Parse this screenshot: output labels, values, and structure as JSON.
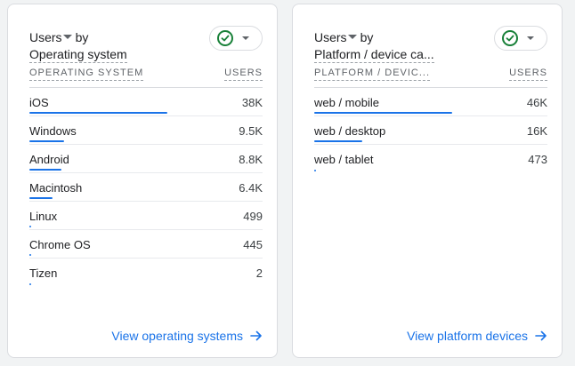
{
  "cards": [
    {
      "metric": "Users",
      "dimension": "Operating system",
      "col_dim": "OPERATING SYSTEM",
      "col_metric": "USERS",
      "link": "View operating systems",
      "rows": [
        {
          "label": "iOS",
          "value": "38K",
          "share": 1.0
        },
        {
          "label": "Windows",
          "value": "9.5K",
          "share": 0.25
        },
        {
          "label": "Android",
          "value": "8.8K",
          "share": 0.23
        },
        {
          "label": "Macintosh",
          "value": "6.4K",
          "share": 0.17
        },
        {
          "label": "Linux",
          "value": "499",
          "share": 0.013
        },
        {
          "label": "Chrome OS",
          "value": "445",
          "share": 0.012
        },
        {
          "label": "Tizen",
          "value": "2",
          "share": 0.0
        }
      ]
    },
    {
      "metric": "Users",
      "dimension": "Platform / device ca...",
      "col_dim": "PLATFORM / DEVIC...",
      "col_metric": "USERS",
      "link": "View platform devices",
      "rows": [
        {
          "label": "web / mobile",
          "value": "46K",
          "share": 1.0
        },
        {
          "label": "web / desktop",
          "value": "16K",
          "share": 0.35
        },
        {
          "label": "web / tablet",
          "value": "473",
          "share": 0.01
        }
      ]
    }
  ],
  "colors": {
    "accent": "#1a73e8",
    "check": "#188038",
    "border": "#dadce0",
    "background": "#f1f3f4"
  },
  "icons": {
    "status": "check-circle-icon",
    "dropdown": "caret-down-icon",
    "link": "arrow-right-icon"
  }
}
